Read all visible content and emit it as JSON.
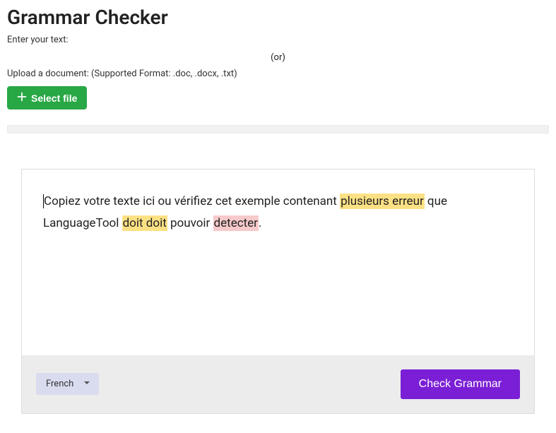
{
  "header": {
    "title": "Grammar Checker",
    "enter_text_label": "Enter your text:",
    "or_label": "(or)",
    "upload_label": "Upload a document: (Supported Format: .doc, .docx, .txt)",
    "select_file_label": "Select file"
  },
  "editor": {
    "segments": [
      {
        "text": "Copiez votre texte ici ou vérifiez cet exemple contenant ",
        "highlight": null
      },
      {
        "text": "plusieurs erreur",
        "highlight": "yellow"
      },
      {
        "text": " que LanguageTool ",
        "highlight": null
      },
      {
        "text": "doit doit",
        "highlight": "yellow"
      },
      {
        "text": " pouvoir ",
        "highlight": null
      },
      {
        "text": "detecter",
        "highlight": "pink"
      },
      {
        "text": ".",
        "highlight": null
      }
    ]
  },
  "footer": {
    "language_selected": "French",
    "check_button_label": "Check Grammar"
  }
}
